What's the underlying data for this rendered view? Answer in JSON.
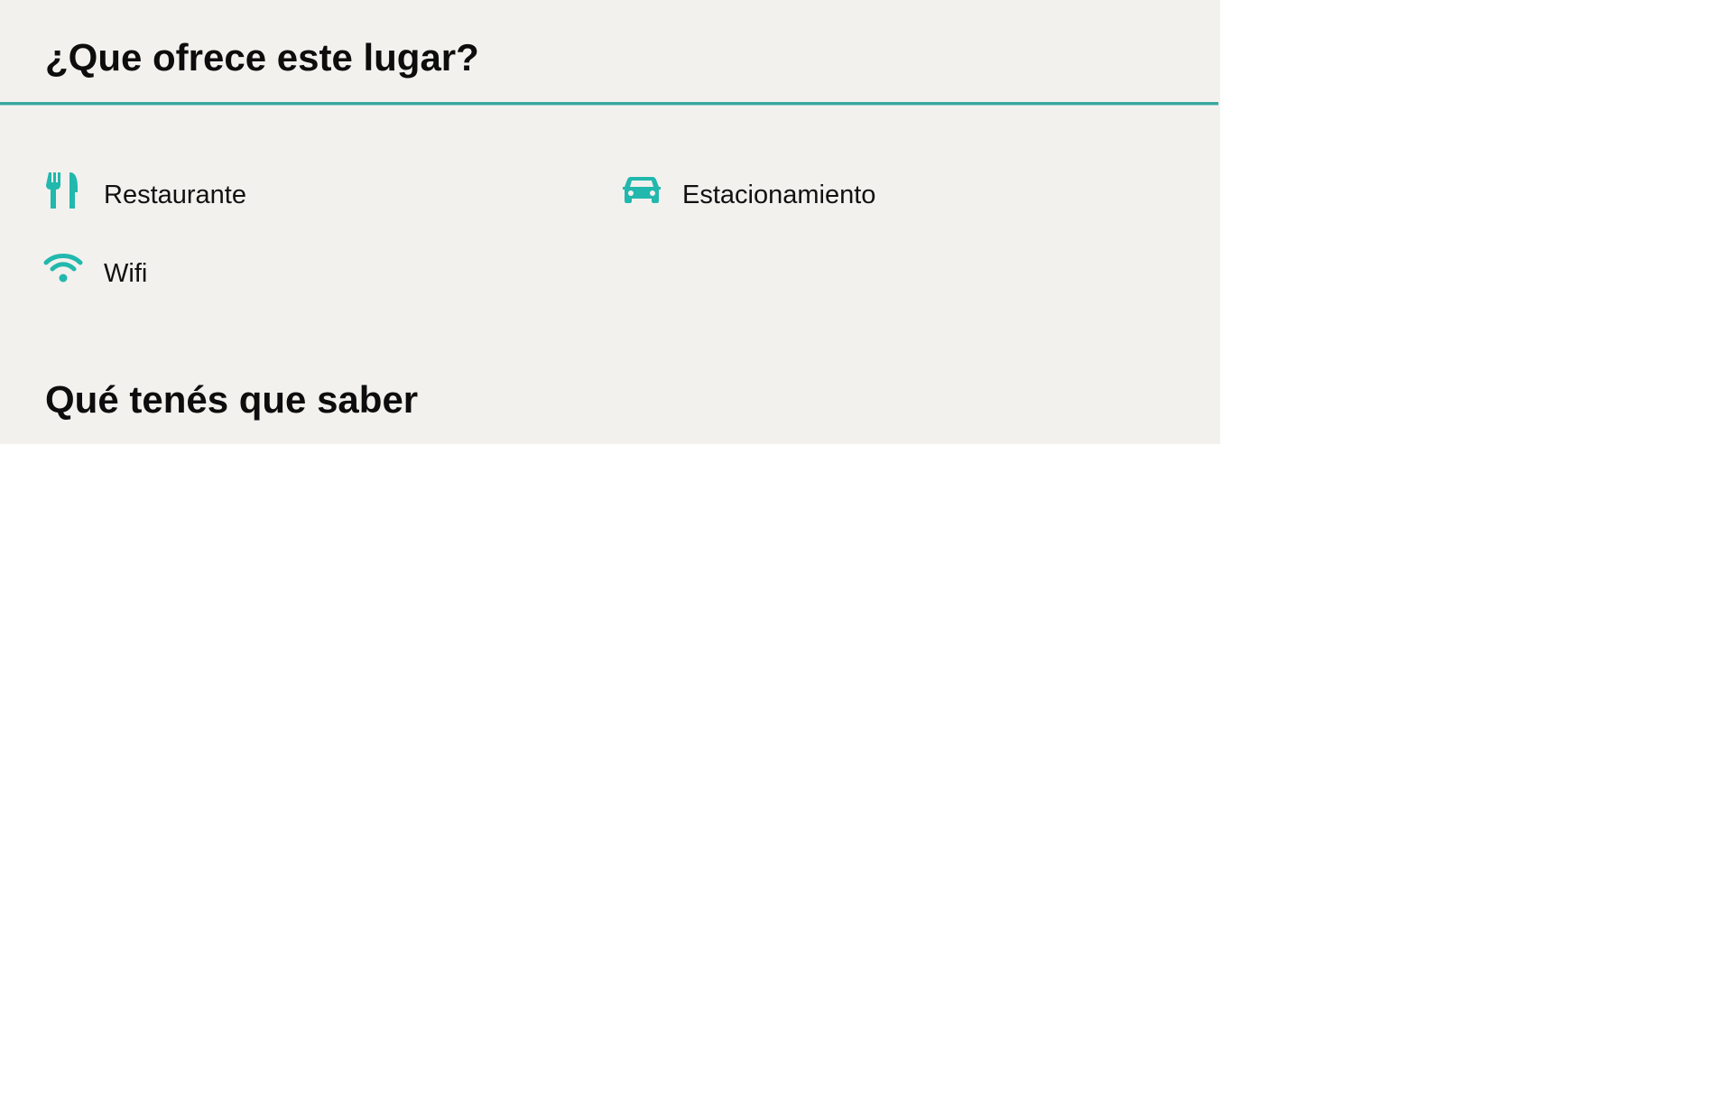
{
  "offers": {
    "title": "¿Que ofrece este lugar?",
    "items": [
      {
        "label": "Restaurante",
        "icon": "fork-knife-icon"
      },
      {
        "label": "Estacionamiento",
        "icon": "car-icon"
      },
      {
        "label": "Wifi",
        "icon": "wifi-icon"
      }
    ]
  },
  "info": {
    "title": "Qué tenés que saber"
  },
  "colors": {
    "accent": "#22b8ad",
    "panel_background": "#f2f1ee",
    "divider": "#3aa79f"
  }
}
